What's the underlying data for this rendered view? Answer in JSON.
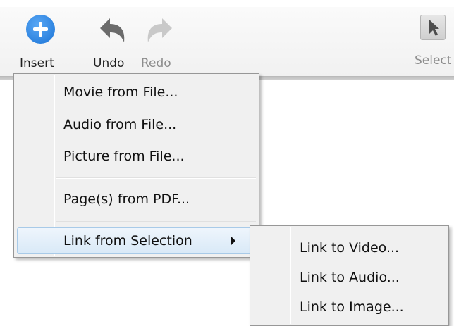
{
  "toolbar": {
    "insert_label": "Insert",
    "undo_label": "Undo",
    "redo_label": "Redo",
    "select_label": "Select"
  },
  "menu": {
    "items": [
      {
        "label": "Movie from File..."
      },
      {
        "label": "Audio from File..."
      },
      {
        "label": "Picture from File..."
      },
      {
        "label": "Page(s) from PDF..."
      },
      {
        "label": "Link from Selection"
      }
    ]
  },
  "submenu": {
    "items": [
      {
        "label": "Link to Video..."
      },
      {
        "label": "Link to Audio..."
      },
      {
        "label": "Link to Image..."
      }
    ]
  },
  "colors": {
    "insert_icon": "#1a73d6",
    "highlight": "#d9e9f7",
    "disabled_text": "#8d8d8d"
  }
}
